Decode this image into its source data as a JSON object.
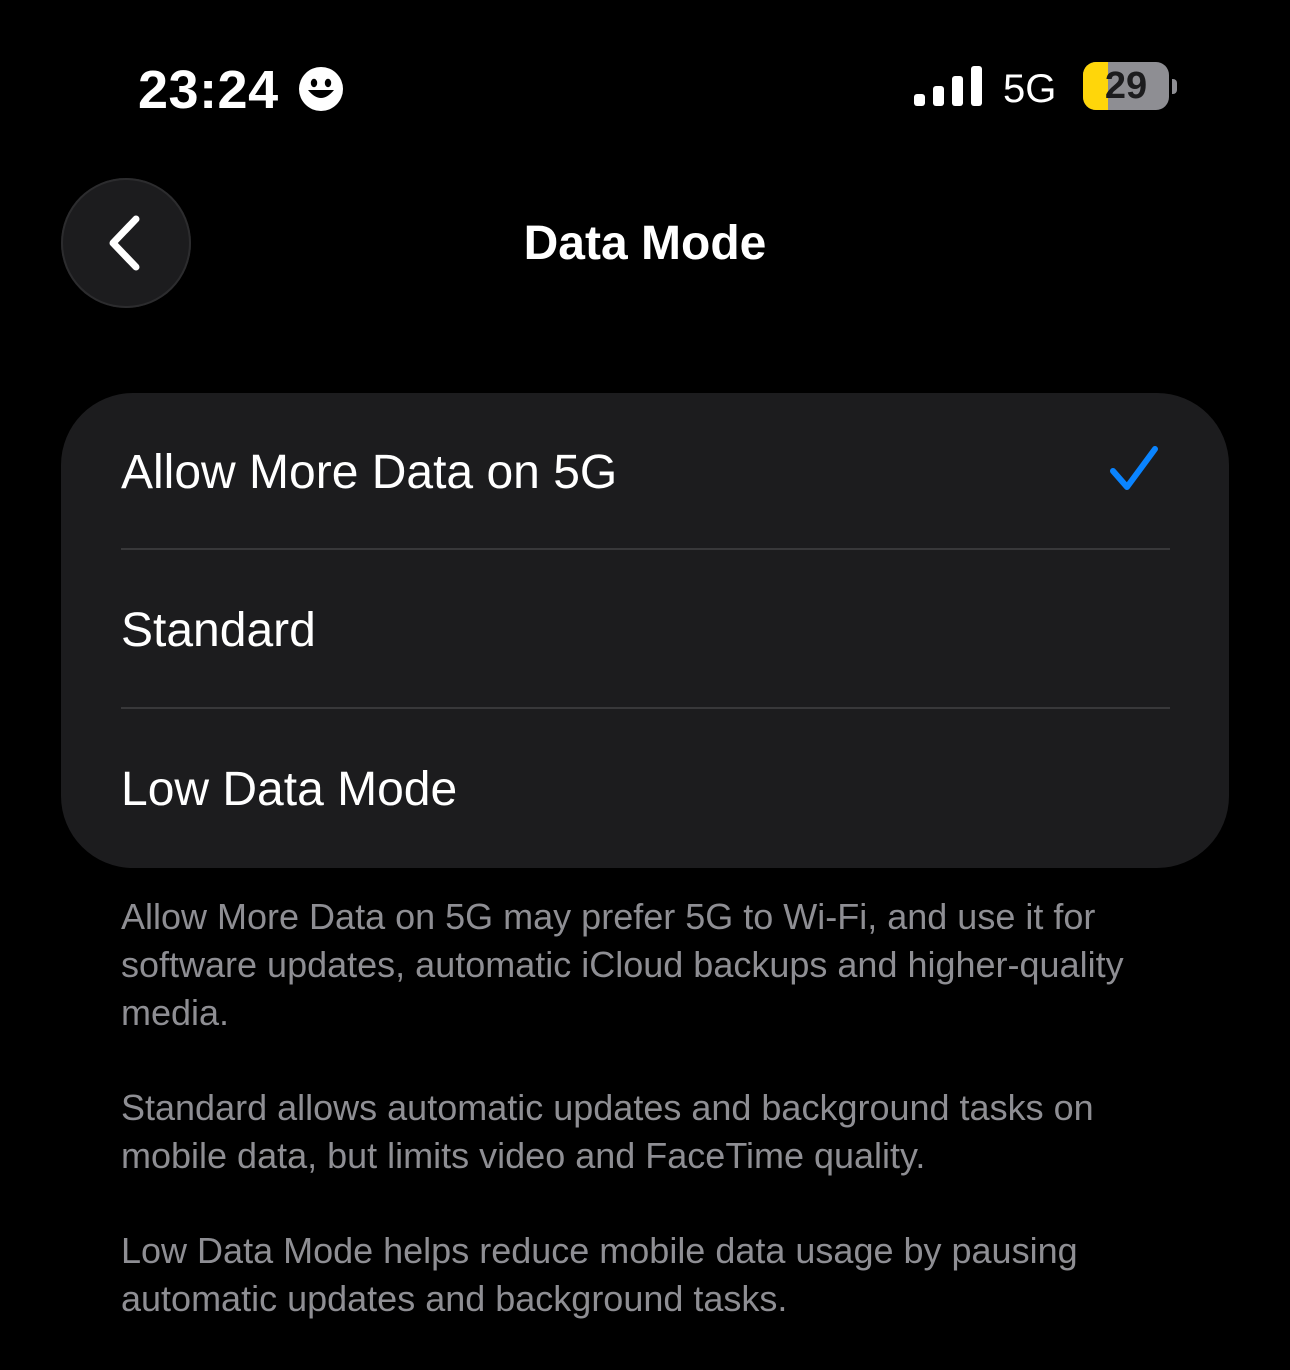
{
  "status_bar": {
    "time": "23:24",
    "focus_icon": "smiling-face-icon",
    "signal_icon": "cellular-signal-icon",
    "signal_bars": 4,
    "network": "5G",
    "battery_level": "29",
    "battery_fraction": 0.29,
    "battery_color": "#ffd60a"
  },
  "nav": {
    "back_icon": "chevron-left-icon",
    "title": "Data Mode"
  },
  "options": [
    {
      "label": "Allow More Data on 5G",
      "selected": true
    },
    {
      "label": "Standard",
      "selected": false
    },
    {
      "label": "Low Data Mode",
      "selected": false
    }
  ],
  "selection": {
    "icon": "checkmark-icon",
    "accent_color": "#0a84ff"
  },
  "footer": {
    "paragraphs": [
      "Allow More Data on 5G may prefer 5G to Wi-Fi, and use it for software updates, automatic iCloud backups and higher-quality media.",
      "Standard allows automatic updates and background tasks on mobile data, but limits video and FaceTime quality.",
      "Low Data Mode helps reduce mobile data usage by pausing automatic updates and background tasks."
    ]
  }
}
